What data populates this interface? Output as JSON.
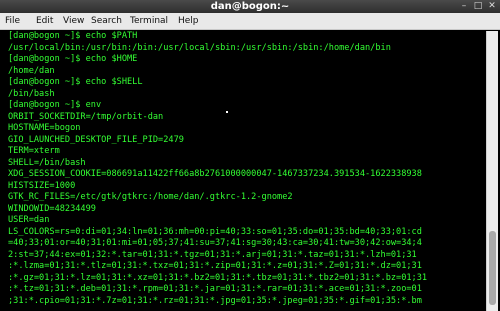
{
  "window": {
    "title": "dan@bogon:~",
    "controls": {
      "minimize": "–",
      "maximize": "□",
      "close": "✕"
    }
  },
  "menu": [
    "File",
    "Edit",
    "View",
    "Search",
    "Terminal",
    "Help"
  ],
  "terminal": {
    "text_color": "#33ff33",
    "background": "#000000",
    "lines": [
      "[dan@bogon ~]$ echo $PATH",
      "/usr/local/bin:/usr/bin:/bin:/usr/local/sbin:/usr/sbin:/sbin:/home/dan/bin",
      "[dan@bogon ~]$ echo $HOME",
      "/home/dan",
      "[dan@bogon ~]$ echo $SHELL",
      "/bin/bash",
      "[dan@bogon ~]$ env",
      "ORBIT_SOCKETDIR=/tmp/orbit-dan",
      "HOSTNAME=bogon",
      "GIO_LAUNCHED_DESKTOP_FILE_PID=2479",
      "TERM=xterm",
      "SHELL=/bin/bash",
      "XDG_SESSION_COOKIE=086691a11422ff66a8b2761000000047-1467337234.391534-1622338938",
      "HISTSIZE=1000",
      "GTK_RC_FILES=/etc/gtk/gtkrc:/home/dan/.gtkrc-1.2-gnome2",
      "WINDOWID=48234499",
      "USER=dan",
      "LS_COLORS=rs=0:di=01;34:ln=01;36:mh=00:pi=40;33:so=01;35:do=01;35:bd=40;33;01:cd",
      "=40;33;01:or=40;31;01:mi=01;05;37;41:su=37;41:sg=30;43:ca=30;41:tw=30;42:ow=34;4",
      "2:st=37;44:ex=01;32:*.tar=01;31:*.tgz=01;31:*.arj=01;31:*.taz=01;31:*.lzh=01;31",
      ":*.lzma=01;31:*.tlz=01;31:*.txz=01;31:*.zip=01;31:*.z=01;31:*.Z=01;31:*.dz=01;31",
      ":*.gz=01;31:*.lz=01;31:*.xz=01;31:*.bz2=01;31:*.tbz=01;31:*.tbz2=01;31:*.bz=01;31",
      ":*.tz=01;31:*.deb=01;31:*.rpm=01;31:*.jar=01;31:*.rar=01;31:*.ace=01;31:*.zoo=01",
      ";31:*.cpio=01;31:*.7z=01;31:*.rz=01;31:*.jpg=01;35:*.jpeg=01;35:*.gif=01;35:*.bm"
    ]
  }
}
